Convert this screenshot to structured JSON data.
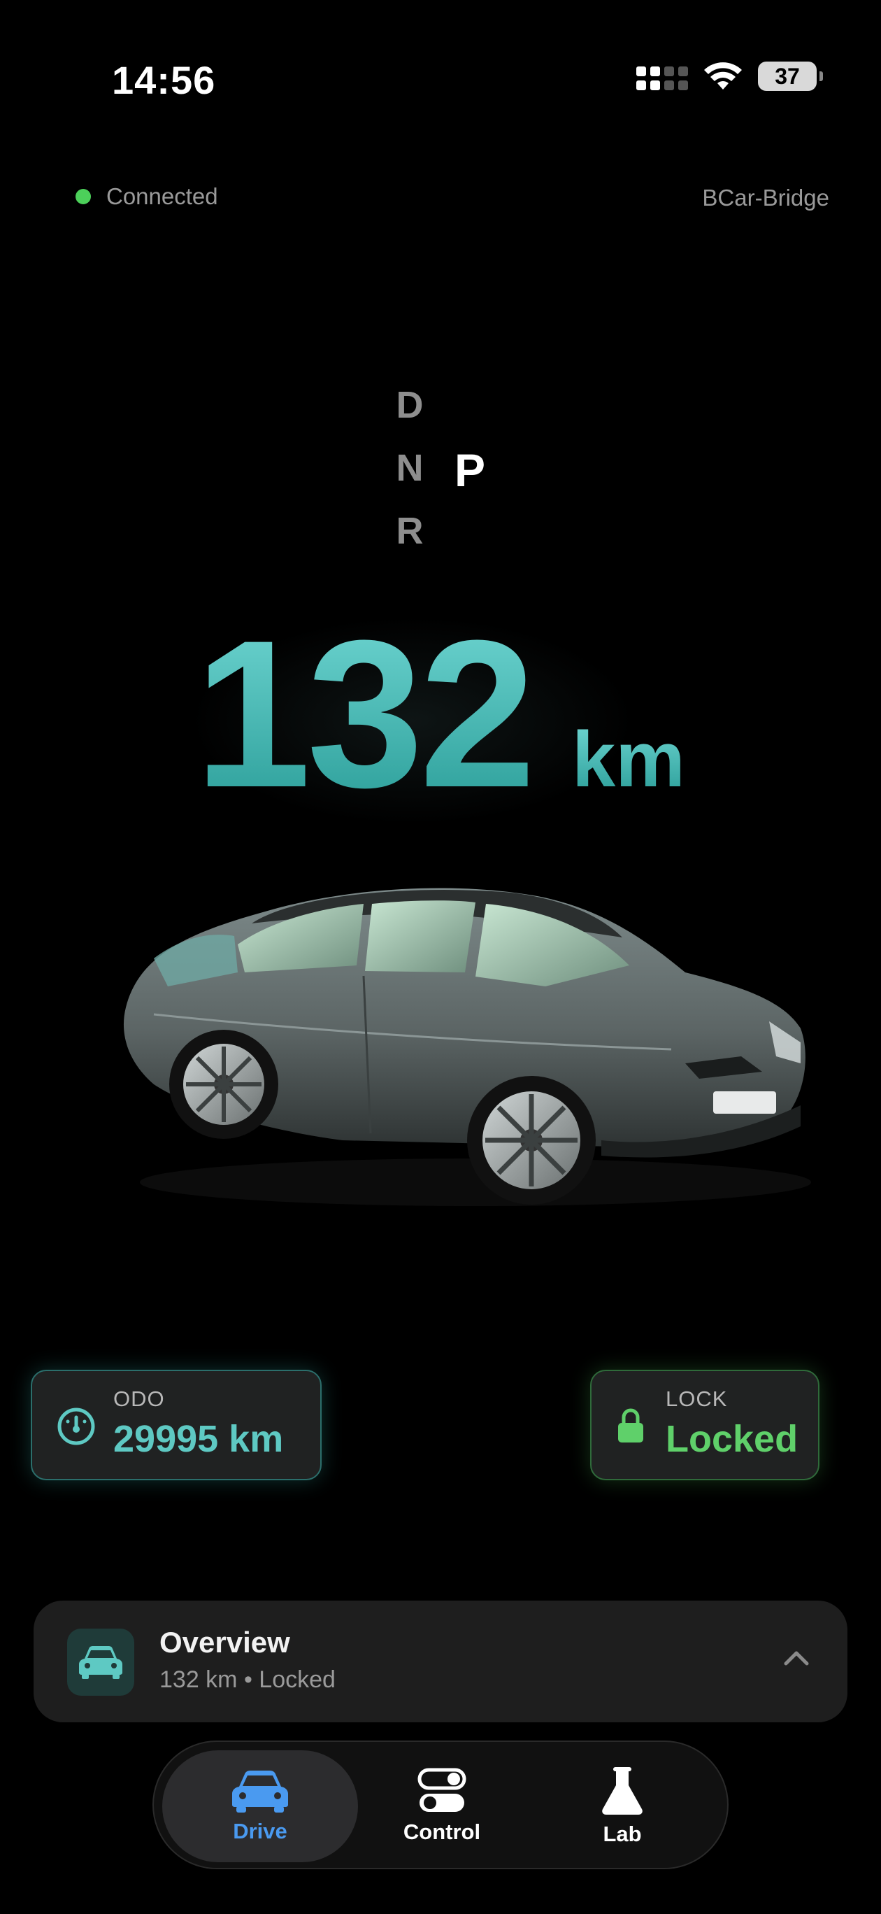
{
  "status_bar": {
    "time": "14:56",
    "battery": "37"
  },
  "connection": {
    "status": "Connected",
    "device": "BCar-Bridge"
  },
  "gear": {
    "options": [
      "D",
      "N",
      "R"
    ],
    "selected": "P"
  },
  "range": {
    "value": "132",
    "unit": "km"
  },
  "odo": {
    "label": "ODO",
    "value": "29995 km"
  },
  "lock": {
    "label": "LOCK",
    "value": "Locked"
  },
  "overview": {
    "title": "Overview",
    "subtitle": "132 km • Locked"
  },
  "tabs": {
    "drive": "Drive",
    "control": "Control",
    "lab": "Lab"
  },
  "colors": {
    "accent_teal": "#5ec9c3",
    "locked_green": "#5fd06a",
    "active_tab_blue": "#4a9af0",
    "connected_green": "#4cd05a"
  }
}
